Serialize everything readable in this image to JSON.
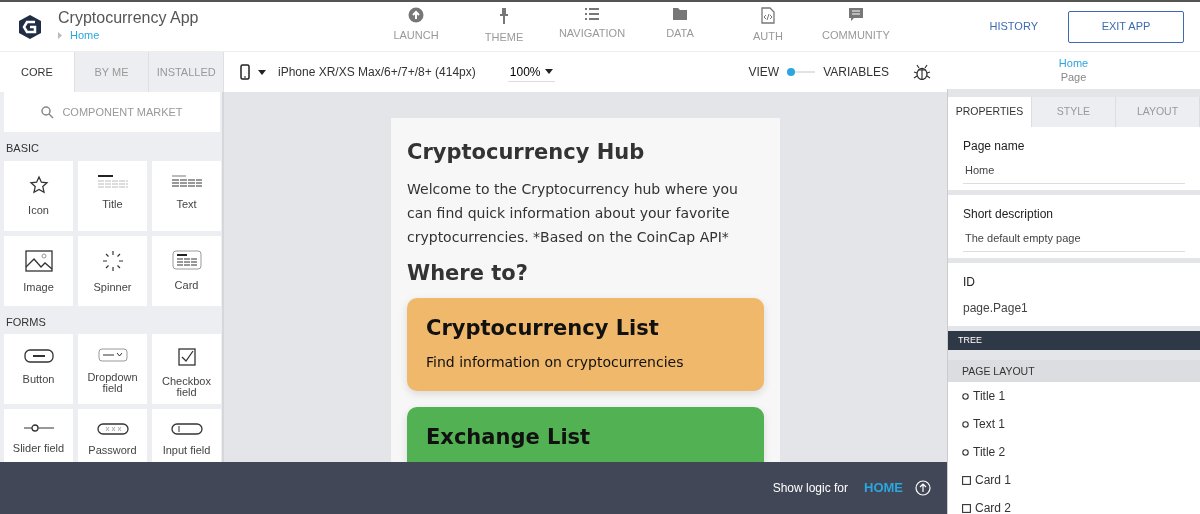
{
  "app": {
    "title": "Cryptocurrency App",
    "breadcrumb": "Home"
  },
  "nav": [
    {
      "label": "LAUNCH",
      "kind": "launch"
    },
    {
      "label": "THEME",
      "kind": "theme"
    },
    {
      "label": "NAVIGATION",
      "kind": "navigation"
    },
    {
      "label": "DATA",
      "kind": "data"
    },
    {
      "label": "AUTH",
      "kind": "auth"
    },
    {
      "label": "COMMUNITY",
      "kind": "community"
    }
  ],
  "actions": {
    "history": "HISTORY",
    "exit": "EXIT APP"
  },
  "component_tabs": [
    {
      "label": "CORE",
      "selected": true
    },
    {
      "label": "BY ME",
      "selected": false
    },
    {
      "label": "INSTALLED",
      "selected": false
    }
  ],
  "component_market": "COMPONENT MARKET",
  "component_groups": [
    {
      "title": "BASIC",
      "items": [
        {
          "label": "Icon",
          "kind": "icon"
        },
        {
          "label": "Title",
          "kind": "title"
        },
        {
          "label": "Text",
          "kind": "text"
        },
        {
          "label": "Image",
          "kind": "image"
        },
        {
          "label": "Spinner",
          "kind": "spinner"
        },
        {
          "label": "Card",
          "kind": "card"
        }
      ]
    },
    {
      "title": "FORMS",
      "items": [
        {
          "label": "Button",
          "kind": "button"
        },
        {
          "label": "Dropdown field",
          "kind": "dropdown"
        },
        {
          "label": "Checkbox field",
          "kind": "checkbox"
        },
        {
          "label": "Slider field",
          "kind": "slider"
        },
        {
          "label": "Password",
          "kind": "password"
        },
        {
          "label": "Input field",
          "kind": "input"
        }
      ]
    }
  ],
  "device": "iPhone XR/XS Max/6+/7+/8+ (414px)",
  "zoom": "100%",
  "view_toggle": {
    "left": "VIEW",
    "right": "VARIABLES",
    "on": false
  },
  "page_header": {
    "title": "Home",
    "subtitle": "Page"
  },
  "preview": {
    "title": "Cryptocurrency Hub",
    "text": "Welcome to the Cryptocurrency hub where you can find quick information about your favorite cryptocurrencies. *Based on the CoinCap API*",
    "heading": "Where to?",
    "cards": [
      {
        "title": "Cryptocurrency List",
        "text": "Find information on cryptocurrencies",
        "color": "#efb86b"
      },
      {
        "title": "Exchange List",
        "color": "#52b152"
      }
    ]
  },
  "logic_bar": {
    "label": "Show logic for",
    "page": "HOME"
  },
  "property_tabs": [
    {
      "label": "PROPERTIES",
      "selected": true
    },
    {
      "label": "STYLE",
      "selected": false
    },
    {
      "label": "LAYOUT",
      "selected": false
    }
  ],
  "properties": [
    {
      "label": "Page name",
      "value": "Home",
      "kind": "input"
    },
    {
      "label": "Short description",
      "value": "The default empty page",
      "kind": "input"
    },
    {
      "label": "ID",
      "value": "page.Page1",
      "kind": "text"
    }
  ],
  "tree": {
    "title": "TREE",
    "section": "PAGE LAYOUT",
    "items": [
      {
        "label": "Title 1",
        "kind": "element"
      },
      {
        "label": "Text 1",
        "kind": "element"
      },
      {
        "label": "Title 2",
        "kind": "element"
      },
      {
        "label": "Card 1",
        "kind": "container"
      },
      {
        "label": "Card 2",
        "kind": "container"
      }
    ]
  }
}
